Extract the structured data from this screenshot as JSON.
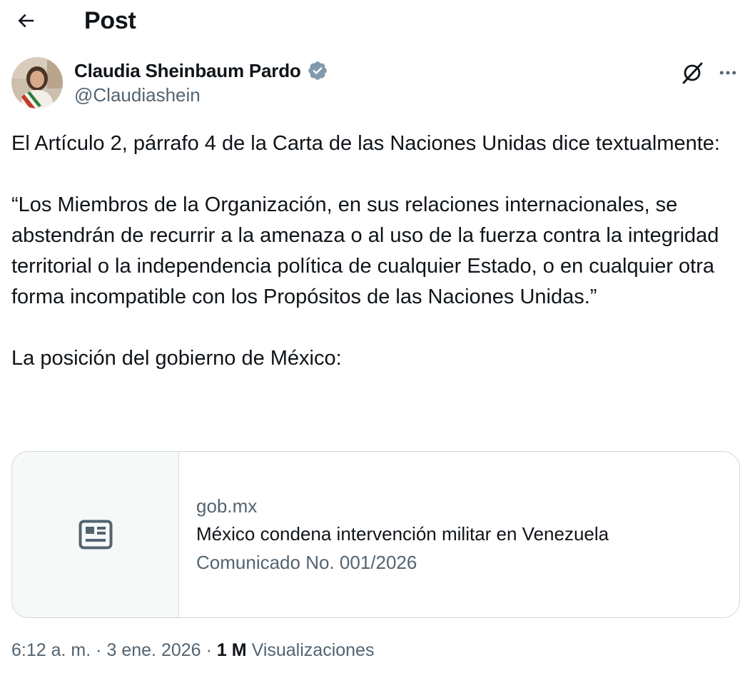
{
  "header": {
    "title": "Post",
    "back_icon": "arrow-left-icon"
  },
  "author": {
    "name": "Claudia Sheinbaum Pardo",
    "handle": "@Claudiashein",
    "verified": true,
    "verified_color": "#829aab"
  },
  "tweet": {
    "paragraphs": [
      "El Artículo 2, párrafo 4 de la Carta de las Naciones Unidas dice textualmente:",
      "“Los Miembros de la Organización, en sus relaciones internacionales, se abstendrán de recurrir a la amenaza o al uso de la fuerza contra la integridad territorial o la independencia política de cualquier Estado, o en cualquier otra forma incompatible con los Propósitos de las Naciones Unidas.”",
      "La posición del gobierno de México:"
    ]
  },
  "card": {
    "domain": "gob.mx",
    "title": "México condena intervención militar en Venezuela",
    "description": "Comunicado No. 001/2026",
    "thumb_icon": "article-icon"
  },
  "meta": {
    "time": "6:12 a. m.",
    "date": "3 ene. 2026",
    "views_count": "1 M",
    "views_label": "Visualizaciones"
  },
  "colors": {
    "text": "#0f1419",
    "secondary": "#536471",
    "border": "#cfd9de"
  }
}
